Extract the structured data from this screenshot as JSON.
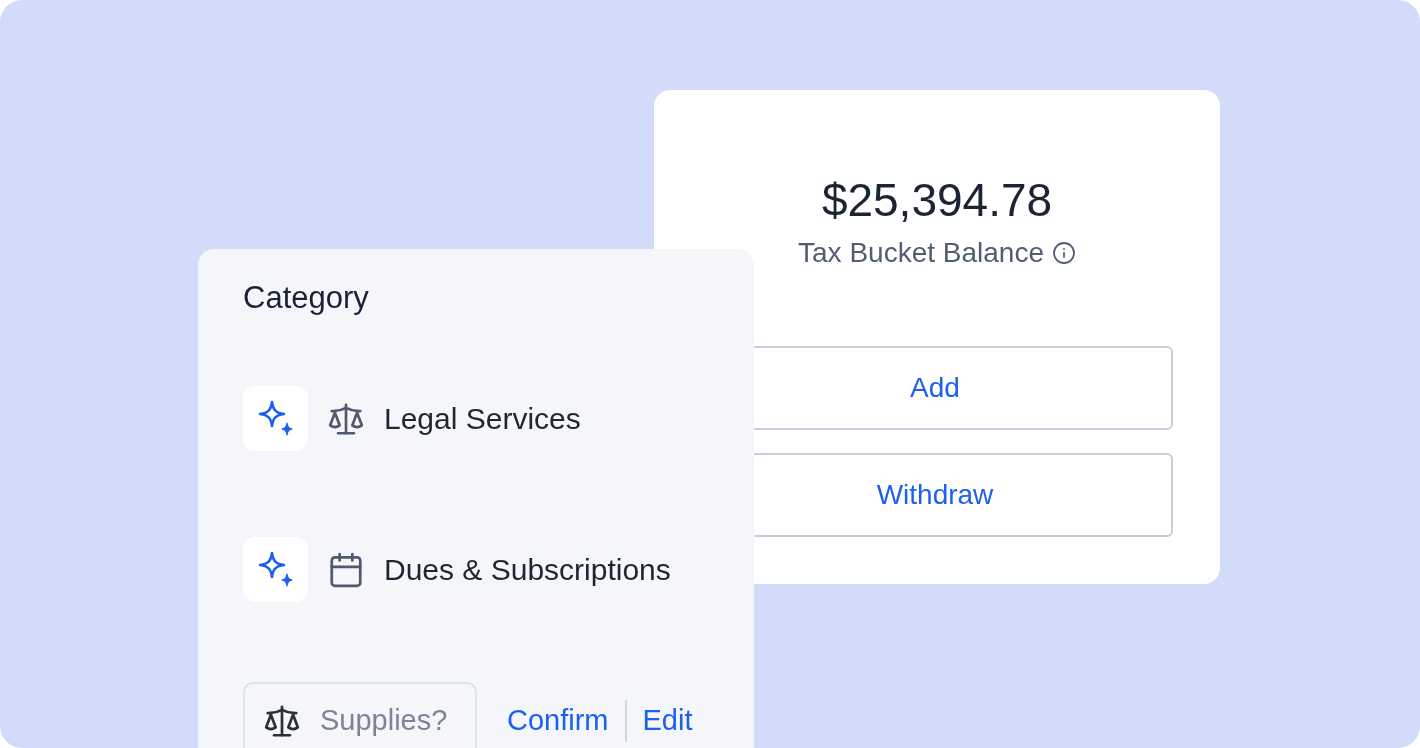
{
  "balance_card": {
    "amount": "$25,394.78",
    "label": "Tax Bucket Balance",
    "buttons": [
      "Add",
      "Withdraw"
    ]
  },
  "category_card": {
    "title": "Category",
    "items": [
      {
        "kind": "scale",
        "label": "Legal Services"
      },
      {
        "kind": "calendar",
        "label": "Dues & Subscriptions"
      }
    ],
    "suggestion": {
      "kind": "scale",
      "label": "Supplies?"
    },
    "actions": [
      "Confirm",
      "Edit"
    ]
  }
}
